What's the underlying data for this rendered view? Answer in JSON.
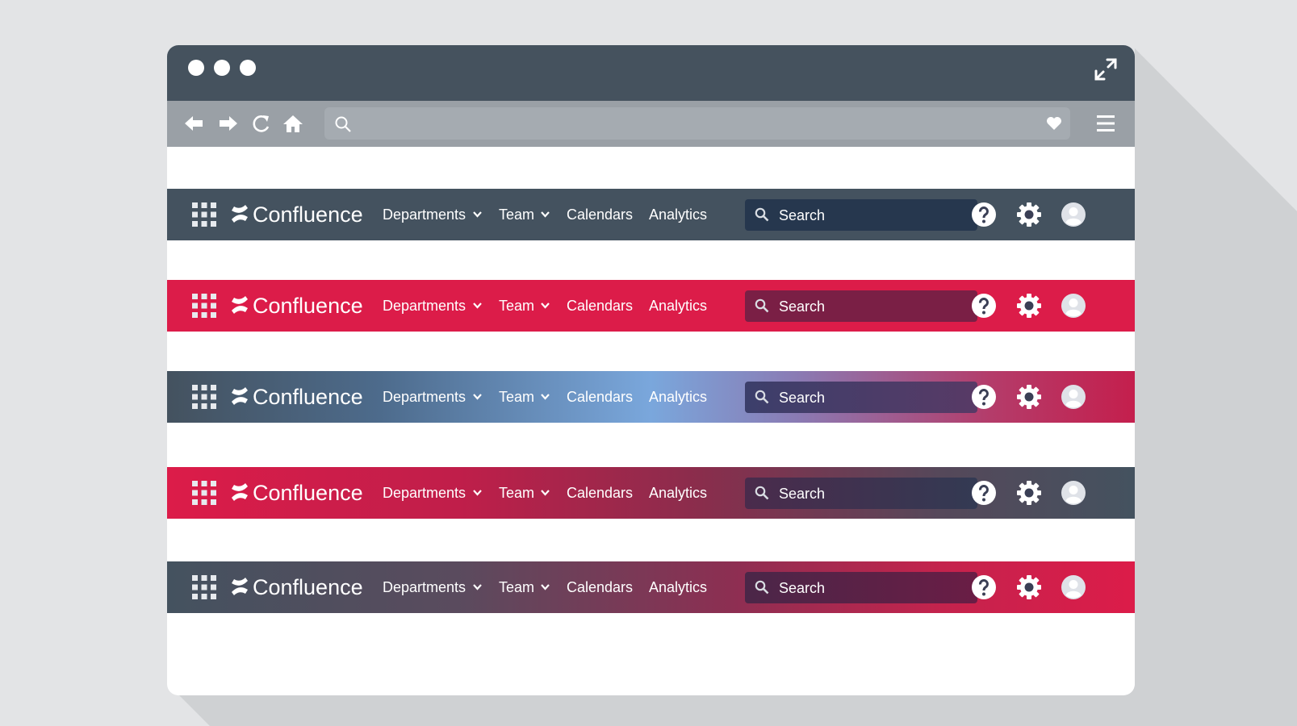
{
  "window": {
    "controls": [
      "close-dot",
      "minimize-dot",
      "maximize-dot"
    ],
    "expand_icon": "expand-icon"
  },
  "browser_toolbar": {
    "icons": [
      "back-arrow-icon",
      "forward-arrow-icon",
      "reload-icon",
      "home-icon"
    ],
    "url_search_icon": "search-icon",
    "bookmark_icon": "heart-icon",
    "menu_icon": "hamburger-menu-icon"
  },
  "navbars": [
    {
      "brand": "Confluence",
      "nav": {
        "departments": "Departments",
        "team": "Team",
        "calendars": "Calendars",
        "analytics": "Analytics"
      },
      "search_label": "Search",
      "style": "slate",
      "colors": {
        "background": "#44525f",
        "search": "#26374e"
      }
    },
    {
      "brand": "Confluence",
      "nav": {
        "departments": "Departments",
        "team": "Team",
        "calendars": "Calendars",
        "analytics": "Analytics"
      },
      "search_label": "Search",
      "style": "crimson",
      "colors": {
        "background": "#dc1c49",
        "search": "#7a1f45"
      }
    },
    {
      "brand": "Confluence",
      "nav": {
        "departments": "Departments",
        "team": "Team",
        "calendars": "Calendars",
        "analytics": "Analytics"
      },
      "search_label": "Search",
      "style": "slate-blue-crimson gradient",
      "colors": {
        "start": "#44525f",
        "middle": "#7aa7dc",
        "end": "#c41f4d"
      }
    },
    {
      "brand": "Confluence",
      "nav": {
        "departments": "Departments",
        "team": "Team",
        "calendars": "Calendars",
        "analytics": "Analytics"
      },
      "search_label": "Search",
      "style": "crimson-to-slate gradient",
      "colors": {
        "start": "#dc1c49",
        "end": "#44525f"
      }
    },
    {
      "brand": "Confluence",
      "nav": {
        "departments": "Departments",
        "team": "Team",
        "calendars": "Calendars",
        "analytics": "Analytics"
      },
      "search_label": "Search",
      "style": "slate-to-crimson gradient",
      "colors": {
        "start": "#44525f",
        "end": "#dc1c49"
      }
    }
  ],
  "navbar_icons": [
    "app-switcher-icon",
    "confluence-logo-icon",
    "chevron-down-icon",
    "search-icon",
    "help-icon",
    "settings-gear-icon",
    "user-avatar-icon"
  ],
  "colors": {
    "page_background": "#e3e4e6",
    "titlebar": "#45525e",
    "browser_toolbar": "#9aa0a6",
    "shadow": "#cfd1d3"
  }
}
